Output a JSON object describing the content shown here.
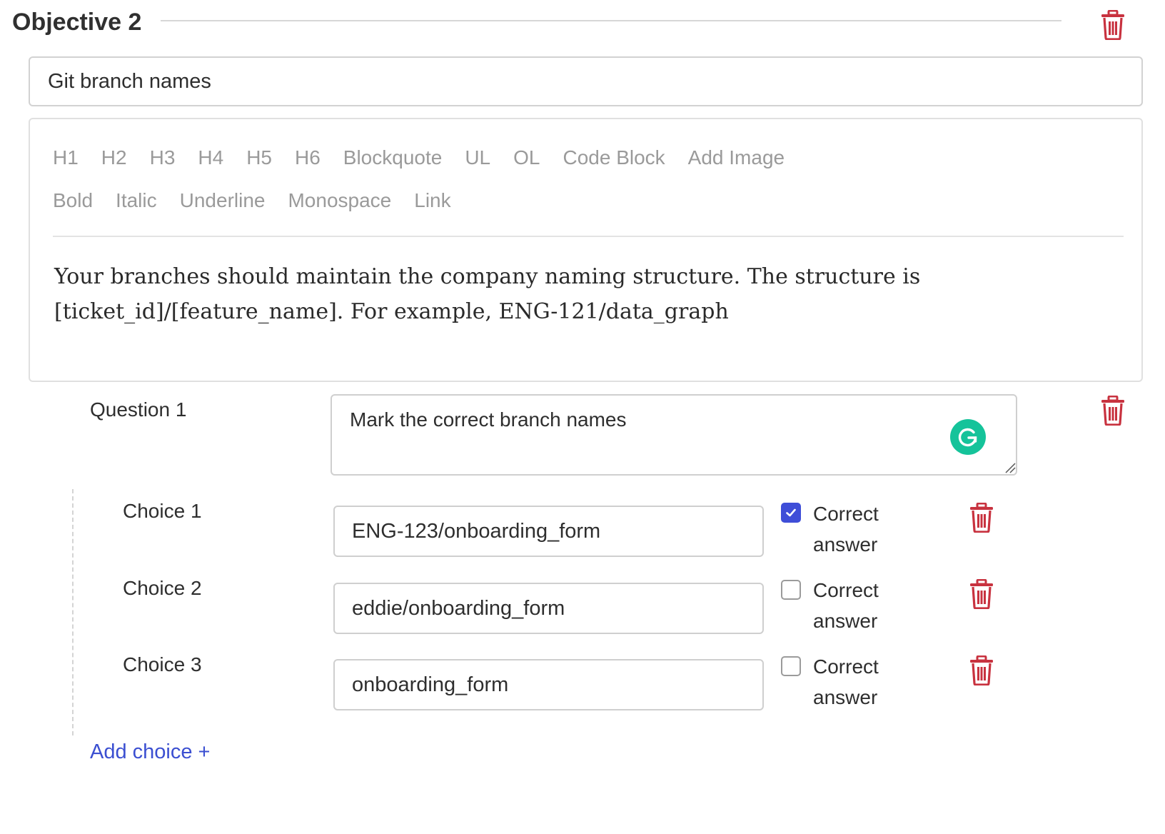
{
  "objective": {
    "title": "Objective 2",
    "name_value": "Git branch names"
  },
  "editor": {
    "toolbar_row1": [
      "H1",
      "H2",
      "H3",
      "H4",
      "H5",
      "H6",
      "Blockquote",
      "UL",
      "OL",
      "Code Block",
      "Add Image"
    ],
    "toolbar_row2": [
      "Bold",
      "Italic",
      "Underline",
      "Monospace",
      "Link"
    ],
    "body_line1": "Your branches should maintain the company naming structure. The structure is",
    "body_line2": "[ticket_id]/[feature_name]. For example, ENG-121/data_graph"
  },
  "question": {
    "label": "Question 1",
    "text": "Mark the correct branch names"
  },
  "choices": [
    {
      "label": "Choice 1",
      "value": "ENG-123/onboarding_form",
      "correct": true,
      "correct_line1": "Correct",
      "correct_line2": "answer"
    },
    {
      "label": "Choice 2",
      "value": "eddie/onboarding_form",
      "correct": false,
      "correct_line1": "Correct",
      "correct_line2": "answer"
    },
    {
      "label": "Choice 3",
      "value": "onboarding_form",
      "correct": false,
      "correct_line1": "Correct",
      "correct_line2": "answer"
    }
  ],
  "add_choice_label": "Add choice +",
  "colors": {
    "delete": "#c8323f",
    "accent": "#3f4ed8",
    "grammarly": "#15c39a",
    "link": "#3b4fd1"
  },
  "icons": {
    "delete": "trash-icon",
    "grammarly": "grammarly-icon",
    "check": "checkmark-icon"
  }
}
